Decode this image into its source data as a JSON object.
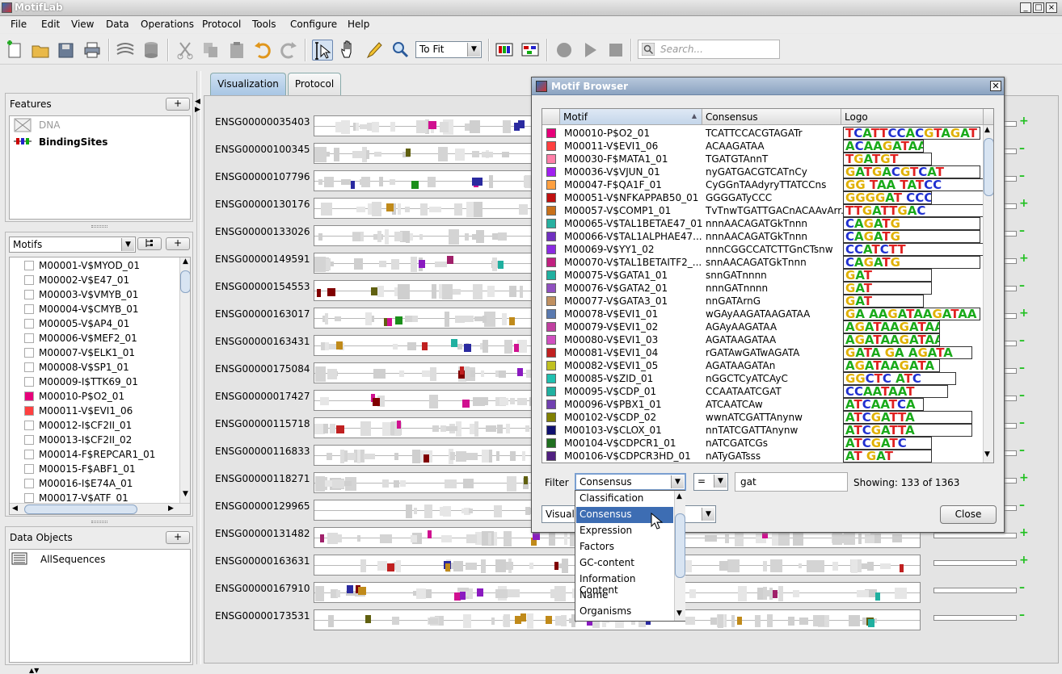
{
  "app": {
    "title": "MotifLab"
  },
  "menubar": [
    "File",
    "Edit",
    "View",
    "Data",
    "Operations",
    "Protocol",
    "Tools",
    "Configure",
    "Help"
  ],
  "toolbar": {
    "zoom_value": "To Fit",
    "search_placeholder": "Search..."
  },
  "features_panel": {
    "title": "Features",
    "add_label": "+",
    "items": [
      {
        "name": "DNA",
        "icon": "dna-track-icon",
        "enabled": false
      },
      {
        "name": "BindingSites",
        "icon": "binding-sites-icon",
        "enabled": true
      }
    ]
  },
  "motifs_panel": {
    "selector": "Motifs",
    "add_label": "+",
    "items": [
      {
        "name": "M00001-V$MYOD_01",
        "color": null
      },
      {
        "name": "M00002-V$E47_01",
        "color": null
      },
      {
        "name": "M00003-V$VMYB_01",
        "color": null
      },
      {
        "name": "M00004-V$CMYB_01",
        "color": null
      },
      {
        "name": "M00005-V$AP4_01",
        "color": null
      },
      {
        "name": "M00006-V$MEF2_01",
        "color": null
      },
      {
        "name": "M00007-V$ELK1_01",
        "color": null
      },
      {
        "name": "M00008-V$SP1_01",
        "color": null
      },
      {
        "name": "M00009-I$TTK69_01",
        "color": null
      },
      {
        "name": "M00010-P$O2_01",
        "color": "#e6007a"
      },
      {
        "name": "M00011-V$EVI1_06",
        "color": "#ff4040"
      },
      {
        "name": "M00012-I$CF2II_01",
        "color": null
      },
      {
        "name": "M00013-I$CF2II_02",
        "color": null
      },
      {
        "name": "M00014-F$REPCAR1_01",
        "color": null
      },
      {
        "name": "M00015-F$ABF1_01",
        "color": null
      },
      {
        "name": "M00016-I$E74A_01",
        "color": null
      },
      {
        "name": "M00017-V$ATF_01",
        "color": null
      }
    ]
  },
  "data_objects_panel": {
    "title": "Data Objects",
    "add_label": "+",
    "items": [
      {
        "name": "AllSequences",
        "icon": "sequence-collection-icon"
      }
    ]
  },
  "tabs": [
    {
      "label": "Visualization",
      "active": true
    },
    {
      "label": "Protocol",
      "active": false
    }
  ],
  "sequences": [
    {
      "name": "ENSG00000035403",
      "expanded": true
    },
    {
      "name": "ENSG00000100345",
      "expanded": false
    },
    {
      "name": "ENSG00000107796",
      "expanded": false
    },
    {
      "name": "ENSG00000130176",
      "expanded": true
    },
    {
      "name": "ENSG00000133026",
      "expanded": false
    },
    {
      "name": "ENSG00000149591",
      "expanded": true
    },
    {
      "name": "ENSG00000154553",
      "expanded": false
    },
    {
      "name": "ENSG00000163017",
      "expanded": true
    },
    {
      "name": "ENSG00000163431",
      "expanded": false
    },
    {
      "name": "ENSG00000175084",
      "expanded": false
    },
    {
      "name": "ENSG00000017427",
      "expanded": false
    },
    {
      "name": "ENSG00000115718",
      "expanded": false
    },
    {
      "name": "ENSG00000116833",
      "expanded": false
    },
    {
      "name": "ENSG00000118271",
      "expanded": true
    },
    {
      "name": "ENSG00000129965",
      "expanded": false
    },
    {
      "name": "ENSG00000131482",
      "expanded": true
    },
    {
      "name": "ENSG00000163631",
      "expanded": true
    },
    {
      "name": "ENSG00000167910",
      "expanded": false
    },
    {
      "name": "ENSG00000173531",
      "expanded": false
    }
  ],
  "motif_browser": {
    "title": "Motif Browser",
    "columns": [
      "Motif",
      "Consensus",
      "Logo"
    ],
    "rows": [
      {
        "motif": "M00010-P$O2_01",
        "consensus": "TCATTCCACGTAGATr",
        "logo": "TCATTCCACGTAGAT",
        "color": "#e6007a"
      },
      {
        "motif": "M00011-V$EVI1_06",
        "consensus": "ACAAGATAA",
        "logo": "ACAAGATAA",
        "color": "#ff4040"
      },
      {
        "motif": "M00030-F$MATA1_01",
        "consensus": "TGATGTAnnT",
        "logo": "TGATGT",
        "color": "#ff7fa8"
      },
      {
        "motif": "M00036-V$VJUN_01",
        "consensus": "nyGATGACGTCATnCy",
        "logo": "GATGACGTCAT",
        "color": "#a020f0"
      },
      {
        "motif": "M00047-F$QA1F_01",
        "consensus": "CyGGnTAAdyryTTATCCns",
        "logo": "GG TAA TATCC",
        "color": "#ffa040"
      },
      {
        "motif": "M00051-V$NFKAPPAB50_01",
        "consensus": "GGGGATyCCC",
        "logo": "GGGGAT CCC",
        "color": "#c01010"
      },
      {
        "motif": "M00057-V$COMP1_01",
        "consensus": "TvTnwTGATTGACnACAAvArr...",
        "logo": "TTGATTGAC",
        "color": "#c8701a"
      },
      {
        "motif": "M00065-V$TAL1BETAE47_01",
        "consensus": "nnnAACAGATGkTnnn",
        "logo": "CAGATG",
        "color": "#28b0a0"
      },
      {
        "motif": "M00066-V$TAL1ALPHAE47...",
        "consensus": "nnnAACAGATGkTnnn",
        "logo": "CAGATG",
        "color": "#7030c0"
      },
      {
        "motif": "M00069-V$YY1_02",
        "consensus": "nnnCGGCCATCTTGnCTsnw",
        "logo": "CCATCTT",
        "color": "#8a2be2"
      },
      {
        "motif": "M00070-V$TAL1BETAITF2_...",
        "consensus": "snnAACAGATGkTnnn",
        "logo": "CAGATG",
        "color": "#c02080"
      },
      {
        "motif": "M00075-V$GATA1_01",
        "consensus": "snnGATnnnn",
        "logo": "GAT",
        "color": "#20b0a0"
      },
      {
        "motif": "M00076-V$GATA2_01",
        "consensus": "nnnGATnnnn",
        "logo": "GAT",
        "color": "#9050c0"
      },
      {
        "motif": "M00077-V$GATA3_01",
        "consensus": "nnGATArnG",
        "logo": "GAT",
        "color": "#c09060"
      },
      {
        "motif": "M00078-V$EVI1_01",
        "consensus": "wGAyAAGATAAGATAA",
        "logo": "GA AAGATAAGATAA",
        "color": "#5a7ab0"
      },
      {
        "motif": "M00079-V$EVI1_02",
        "consensus": "AGAyAAGATAA",
        "logo": "AGATAAGATAA",
        "color": "#c040a0"
      },
      {
        "motif": "M00080-V$EVI1_03",
        "consensus": "AGATAAGATAA",
        "logo": "AGATAAGATAA",
        "color": "#d050c0"
      },
      {
        "motif": "M00081-V$EVI1_04",
        "consensus": "rGATAwGATwAGATA",
        "logo": "GATA GA AGATA",
        "color": "#c02020"
      },
      {
        "motif": "M00082-V$EVI1_05",
        "consensus": "AGATAAGATAn",
        "logo": "AGATAAGATA",
        "color": "#c0c020"
      },
      {
        "motif": "M00085-V$ZID_01",
        "consensus": "nGGCTCyATCAyC",
        "logo": "GGCTC ATC",
        "color": "#20c0b0"
      },
      {
        "motif": "M00095-V$CDP_01",
        "consensus": "CCAATAATCGAT",
        "logo": "CCAATAAT",
        "color": "#20b0a0"
      },
      {
        "motif": "M00096-V$PBX1_01",
        "consensus": "ATCAATCAw",
        "logo": "ATCAATCA",
        "color": "#7040b0"
      },
      {
        "motif": "M00102-V$CDP_02",
        "consensus": "wwnATCGATTAnynw",
        "logo": "ATCGATTA",
        "color": "#808000"
      },
      {
        "motif": "M00103-V$CLOX_01",
        "consensus": "nnTATCGATTAnynw",
        "logo": "ATCGATTA",
        "color": "#101070"
      },
      {
        "motif": "M00104-V$CDPCR1_01",
        "consensus": "nATCGATCGs",
        "logo": "ATCGATC",
        "color": "#207020"
      },
      {
        "motif": "M00106-V$CDPCR3HD_01",
        "consensus": "nATyGATsss",
        "logo": "AT GAT",
        "color": "#502080"
      }
    ],
    "filter_label": "Filter",
    "filter_field": "Consensus",
    "filter_operator": "=",
    "filter_value": "gat",
    "showing": "Showing: 133 of 1363",
    "visual_label": "Visuali",
    "close_label": "Close",
    "filter_options": [
      "Classification",
      "Consensus",
      "Expression",
      "Factors",
      "GC-content",
      "Information Content",
      "Name",
      "Organisms"
    ],
    "selected_option": "Consensus"
  }
}
